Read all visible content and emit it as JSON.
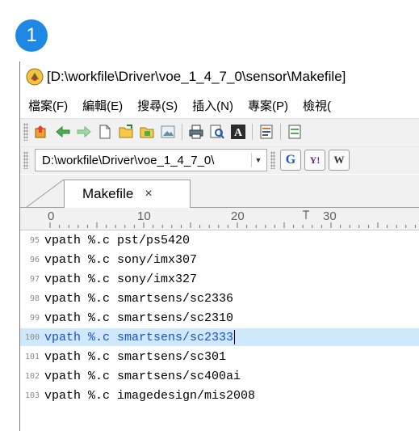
{
  "step_badge": "1",
  "window": {
    "title": "[D:\\workfile\\Driver\\voe_1_4_7_0\\sensor\\Makefile]",
    "menu": [
      "檔案(F)",
      "編輯(E)",
      "搜尋(S)",
      "插入(N)",
      "專案(P)",
      "檢視("
    ],
    "address": "D:\\workfile\\Driver\\voe_1_4_7_0\\",
    "search_buttons": [
      "G",
      "Y!",
      "W"
    ],
    "tab_label": "Makefile",
    "tab_close": "×",
    "ruler_numbers": [
      "0",
      "10",
      "20",
      "30"
    ],
    "lines": [
      {
        "num": "95",
        "text": "vpath %.c pst/ps5420"
      },
      {
        "num": "96",
        "text": "vpath %.c sony/imx307"
      },
      {
        "num": "97",
        "text": "vpath %.c sony/imx327"
      },
      {
        "num": "98",
        "text": "vpath %.c smartsens/sc2336"
      },
      {
        "num": "99",
        "text": "vpath %.c smartsens/sc2310"
      },
      {
        "num": "100",
        "text": "vpath %.c smartsens/sc2333"
      },
      {
        "num": "101",
        "text": "vpath %.c smartsens/sc301"
      },
      {
        "num": "102",
        "text": "vpath %.c smartsens/sc400ai"
      },
      {
        "num": "103",
        "text": "vpath %.c imagedesign/mis2008"
      }
    ],
    "current_line_index": 5
  },
  "colors": {
    "badge": "#1e88e5",
    "current_line": "#cfe8fc",
    "toolbar_bg": "#f1f1f1"
  }
}
